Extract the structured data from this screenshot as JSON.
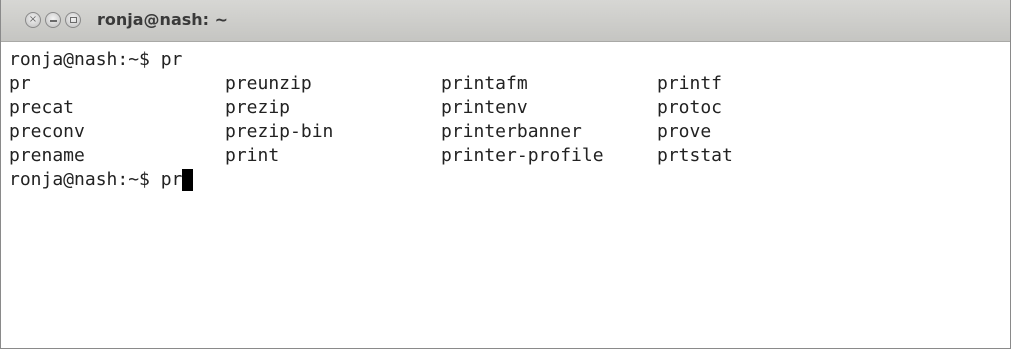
{
  "window": {
    "title": "ronja@nash: ~"
  },
  "terminal": {
    "prompt_line_1": "ronja@nash:~$ pr",
    "completions": [
      [
        "pr",
        "preunzip",
        "printafm",
        "printf"
      ],
      [
        "precat",
        "prezip",
        "printenv",
        "protoc"
      ],
      [
        "preconv",
        "prezip-bin",
        "printerbanner",
        "prove"
      ],
      [
        "prename",
        "print",
        "printer-profile",
        "prtstat"
      ]
    ],
    "prompt_line_2": "ronja@nash:~$ pr"
  },
  "icons": {
    "close": "close-icon",
    "minimize": "minimize-icon",
    "maximize": "maximize-icon"
  }
}
